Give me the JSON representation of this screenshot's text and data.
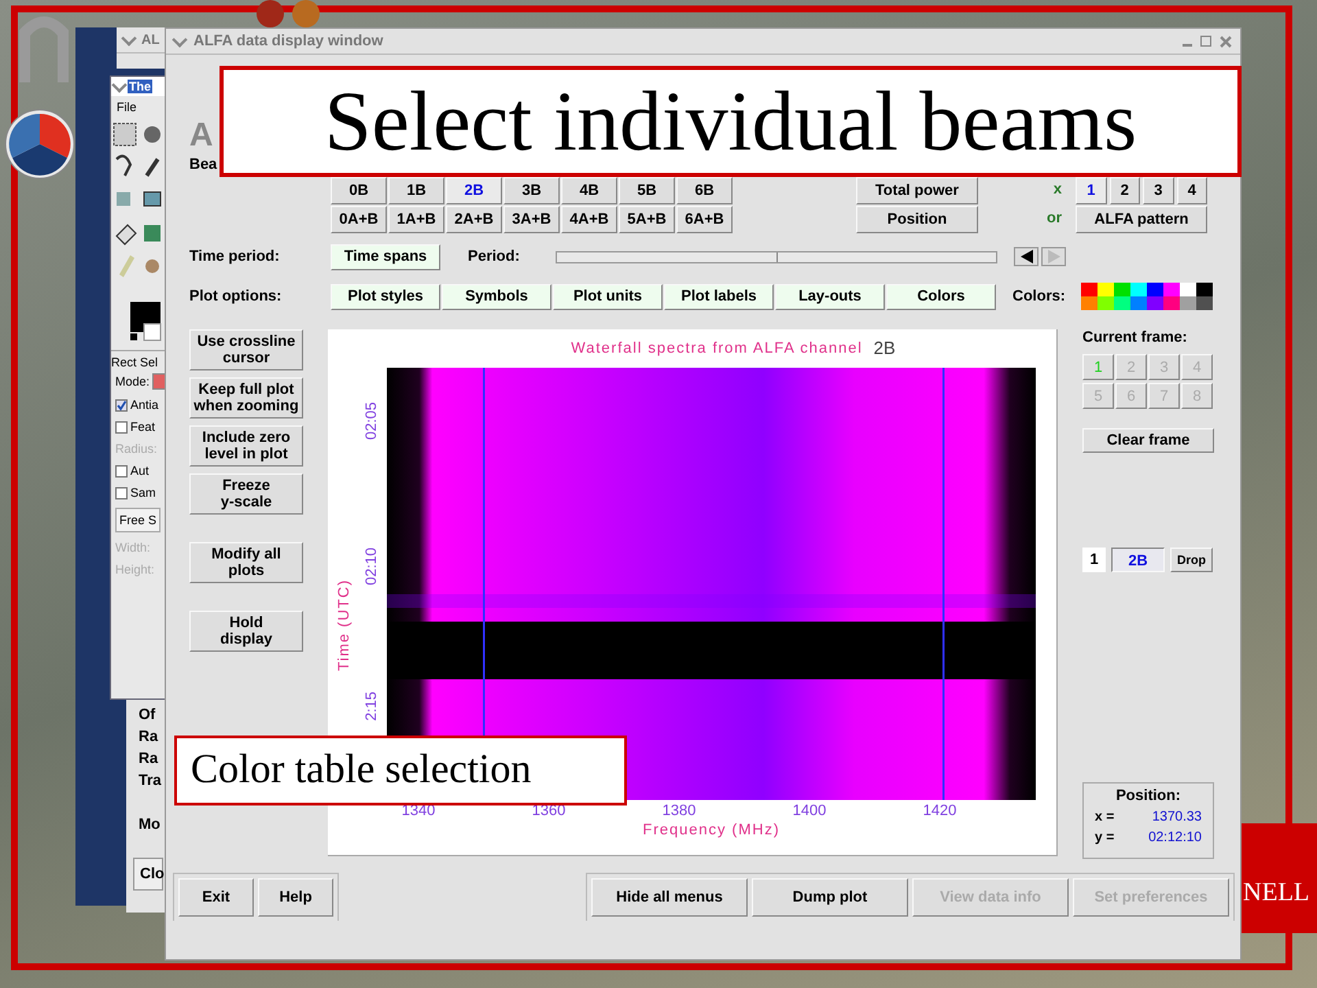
{
  "slide": {
    "title": "Select individual beams",
    "caption": "Color table selection",
    "corner_text": "NELL"
  },
  "back_window": {
    "title": "AL"
  },
  "toolbox": {
    "title": "The",
    "menu": [
      "File"
    ],
    "tool_options_title": "Rect Sel",
    "mode_label": "Mode:",
    "options": [
      {
        "label": "Antia",
        "kind": "checkbox",
        "checked": true
      },
      {
        "label": "Feat",
        "kind": "checkbox",
        "checked": false
      },
      {
        "label": "Radius:",
        "kind": "label"
      },
      {
        "label": "Aut",
        "kind": "checkbox",
        "checked": false
      },
      {
        "label": "Sam",
        "kind": "checkbox",
        "checked": false
      },
      {
        "label": "Free S",
        "kind": "dropdown"
      },
      {
        "label": "Width:",
        "kind": "label"
      },
      {
        "label": "Height:",
        "kind": "label"
      }
    ]
  },
  "lower_window": {
    "labels": [
      "Of",
      "Ra",
      "Ra",
      "Tra",
      "Mo"
    ],
    "button": "Clo"
  },
  "window": {
    "title": "ALFA data display window",
    "logo_text": "A",
    "beams_label": "Bea",
    "beams": [
      [
        {
          "label": "0B",
          "selected": false
        },
        {
          "label": "1B",
          "selected": false
        },
        {
          "label": "2B",
          "selected": true
        },
        {
          "label": "3B",
          "selected": false
        },
        {
          "label": "4B",
          "selected": false
        },
        {
          "label": "5B",
          "selected": false
        },
        {
          "label": "6B",
          "selected": false
        }
      ],
      [
        {
          "label": "0A+B",
          "selected": false
        },
        {
          "label": "1A+B",
          "selected": false
        },
        {
          "label": "2A+B",
          "selected": false
        },
        {
          "label": "3A+B",
          "selected": false
        },
        {
          "label": "4A+B",
          "selected": false
        },
        {
          "label": "5A+B",
          "selected": false
        },
        {
          "label": "6A+B",
          "selected": false
        }
      ]
    ],
    "mode_buttons": [
      "Total power",
      "Position"
    ],
    "joiners": [
      "x",
      "or"
    ],
    "pattern_numbers": [
      {
        "label": "1",
        "selected": true
      },
      {
        "label": "2",
        "selected": false
      },
      {
        "label": "3",
        "selected": false
      },
      {
        "label": "4",
        "selected": false
      }
    ],
    "pattern_button": "ALFA pattern",
    "time_period": {
      "label": "Time period:",
      "button": "Time spans",
      "period_label": "Period:",
      "level": 0.5
    },
    "plot_options": {
      "label": "Plot options:",
      "buttons": [
        "Plot styles",
        "Symbols",
        "Plot units",
        "Plot labels",
        "Lay-outs",
        "Colors"
      ],
      "colors_label": "Colors:",
      "colors": [
        {
          "color": "#ff0000"
        },
        {
          "color": "#ffff00"
        },
        {
          "color": "#00e000"
        },
        {
          "color": "#00ffff"
        },
        {
          "color": "#0000ff"
        },
        {
          "color": "#ff00ff"
        },
        {
          "color": "#ffffff"
        },
        {
          "color": "#000000"
        },
        {
          "color": "#ff8000"
        },
        {
          "color": "#80ff00"
        },
        {
          "color": "#00ff80"
        },
        {
          "color": "#0080ff"
        },
        {
          "color": "#8000ff"
        },
        {
          "color": "#ff0080"
        },
        {
          "color": "#a0a0a0"
        },
        {
          "color": "#505050"
        }
      ]
    },
    "side_buttons": [
      "Use crossline cursor",
      "Keep full plot when zooming",
      "Include zero level in plot",
      "Freeze y-scale",
      "Modify all plots",
      "Hold display"
    ],
    "plot": {
      "title": "Waterfall spectra from ALFA channel",
      "channel": "2B",
      "ylabel": "Time (UTC)",
      "yticks": [
        "02:05",
        "02:10",
        "2:15"
      ],
      "xticks": [
        "1340",
        "1360",
        "1380",
        "1400",
        "1420"
      ],
      "xlabel": "Frequency (MHz)"
    },
    "current_frame": {
      "label": "Current frame:",
      "frames": [
        {
          "label": "1",
          "selected": true,
          "disabled": false
        },
        {
          "label": "2",
          "selected": false,
          "disabled": true
        },
        {
          "label": "3",
          "selected": false,
          "disabled": true
        },
        {
          "label": "4",
          "selected": false,
          "disabled": true
        },
        {
          "label": "5",
          "selected": false,
          "disabled": true
        },
        {
          "label": "6",
          "selected": false,
          "disabled": true
        },
        {
          "label": "7",
          "selected": false,
          "disabled": true
        },
        {
          "label": "8",
          "selected": false,
          "disabled": true
        }
      ],
      "clear_button": "Clear frame",
      "slot": "1",
      "slot_beam": "2B",
      "drop_button": "Drop"
    },
    "position": {
      "label": "Position:",
      "x_label": "x =",
      "x_value": "1370.33",
      "y_label": "y =",
      "y_value": "02:12:10"
    },
    "bottom_left": [
      {
        "label": "Exit",
        "disabled": false
      },
      {
        "label": "Help",
        "disabled": false
      }
    ],
    "bottom_right": [
      {
        "label": "Hide all menus",
        "disabled": false
      },
      {
        "label": "Dump plot",
        "disabled": false
      },
      {
        "label": "View data info",
        "disabled": true
      },
      {
        "label": "Set preferences",
        "disabled": true
      }
    ]
  }
}
